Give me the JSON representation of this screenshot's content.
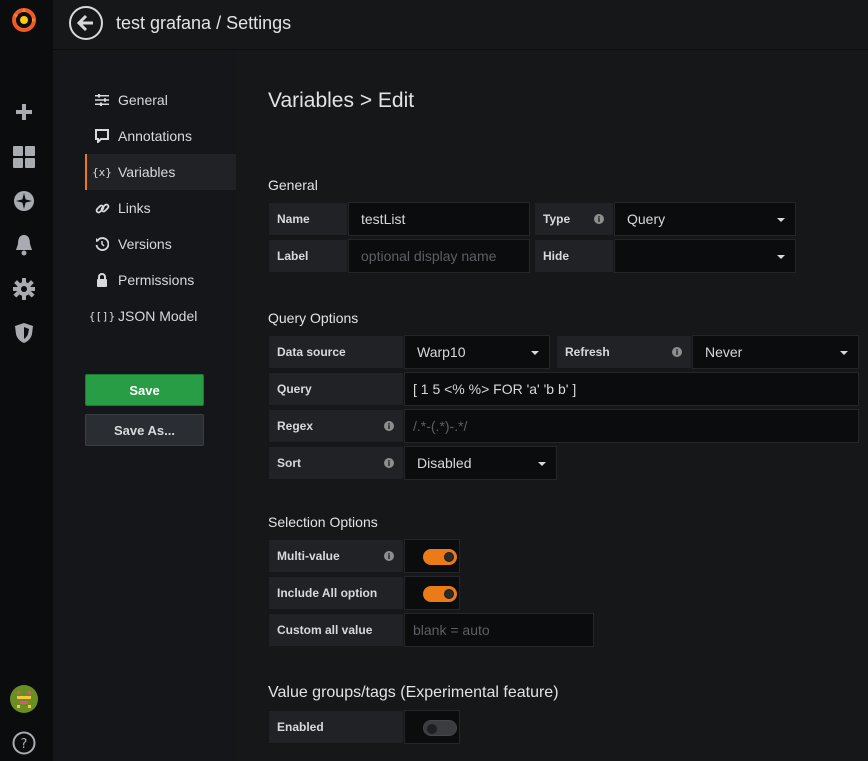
{
  "topbar": {
    "title": "test grafana / Settings"
  },
  "nav": {
    "items": [
      {
        "label": "General",
        "icon": "sliders-icon"
      },
      {
        "label": "Annotations",
        "icon": "comment-icon"
      },
      {
        "label": "Variables",
        "icon": "variable-icon",
        "glyph": "{x}"
      },
      {
        "label": "Links",
        "icon": "link-icon"
      },
      {
        "label": "Versions",
        "icon": "history-icon"
      },
      {
        "label": "Permissions",
        "icon": "lock-icon"
      },
      {
        "label": "JSON Model",
        "icon": "json-icon",
        "glyph": "{[]}"
      }
    ],
    "save_label": "Save",
    "save_as_label": "Save As..."
  },
  "page": {
    "title": "Variables > Edit"
  },
  "general": {
    "title": "General",
    "name_label": "Name",
    "name_value": "testList",
    "type_label": "Type",
    "type_value": "Query",
    "label_label": "Label",
    "label_placeholder": "optional display name",
    "hide_label": "Hide",
    "hide_value": ""
  },
  "query_options": {
    "title": "Query Options",
    "datasource_label": "Data source",
    "datasource_value": "Warp10",
    "refresh_label": "Refresh",
    "refresh_value": "Never",
    "query_label": "Query",
    "query_value": "[ 1 5 <% %> FOR 'a' 'b b' ]",
    "regex_label": "Regex",
    "regex_placeholder": "/.*-(.*)-.*/",
    "sort_label": "Sort",
    "sort_value": "Disabled"
  },
  "selection_options": {
    "title": "Selection Options",
    "multi_label": "Multi-value",
    "multi_on": true,
    "include_all_label": "Include All option",
    "include_all_on": true,
    "custom_all_label": "Custom all value",
    "custom_all_placeholder": "blank = auto"
  },
  "value_groups": {
    "title": "Value groups/tags (Experimental feature)",
    "enabled_label": "Enabled",
    "enabled_on": false
  },
  "colors": {
    "accent": "#eb7b18",
    "save": "#299c46"
  }
}
